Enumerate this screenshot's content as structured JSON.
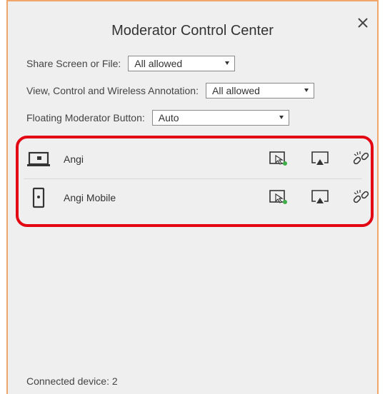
{
  "dialog": {
    "title": "Moderator Control Center",
    "close_icon": "close-icon"
  },
  "settings": {
    "share": {
      "label": "Share Screen or File:",
      "value": "All allowed"
    },
    "view": {
      "label": "View, Control and Wireless Annotation:",
      "value": "All allowed"
    },
    "floating": {
      "label": "Floating Moderator Button:",
      "value": "Auto"
    }
  },
  "devices": [
    {
      "name": "Angi",
      "icon": "laptop-icon",
      "actions": [
        "screen-share-icon",
        "cast-icon",
        "disconnect-icon"
      ]
    },
    {
      "name": "Angi Mobile",
      "icon": "mobile-phone-icon",
      "actions": [
        "screen-share-icon",
        "cast-icon",
        "disconnect-icon"
      ]
    }
  ],
  "footer": {
    "connected": "Connected device: 2"
  },
  "colors": {
    "panel_border": "#f0a56a",
    "highlight": "#e30613",
    "status_green": "#3fae49",
    "background": "#efefef"
  }
}
